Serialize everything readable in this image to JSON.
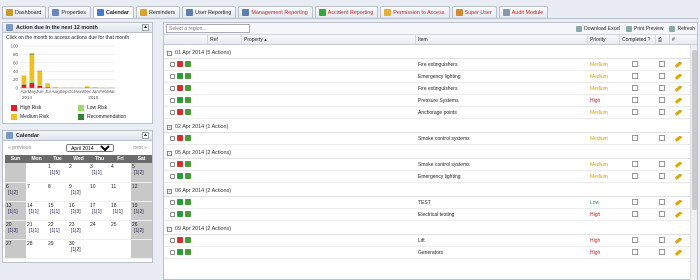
{
  "tabs": [
    {
      "label": "Dashboard",
      "color": "#c79a2b",
      "active": false,
      "red": false
    },
    {
      "label": "Properties",
      "color": "#6a88b5",
      "active": false,
      "red": false
    },
    {
      "label": "Calendar",
      "color": "#4a7cc2",
      "active": true,
      "red": false
    },
    {
      "label": "Reminders",
      "color": "#d9a233",
      "active": false,
      "red": false
    },
    {
      "label": "User Reporting",
      "color": "#5c7fb0",
      "active": false,
      "red": false
    },
    {
      "label": "Management Reporting",
      "color": "#5c7fb0",
      "active": false,
      "red": true
    },
    {
      "label": "Accident Reporting",
      "color": "#3aa33a",
      "active": false,
      "red": true
    },
    {
      "label": "Permission to Access",
      "color": "#e3b13a",
      "active": false,
      "red": true
    },
    {
      "label": "Super User",
      "color": "#d18b33",
      "active": false,
      "red": true
    },
    {
      "label": "Audit Module",
      "color": "#8899aa",
      "active": false,
      "red": true
    }
  ],
  "actions_panel": {
    "title": "Action due in the next 12 month",
    "hint": "Click on the month to access actions due for that month",
    "legend": [
      {
        "label": "High Risk",
        "color": "#e02020"
      },
      {
        "label": "Low Risk",
        "color": "#99dd66"
      },
      {
        "label": "Medium Risk",
        "color": "#f0c020"
      },
      {
        "label": "Recommendation",
        "color": "#2a8a2a"
      }
    ]
  },
  "chart_data": {
    "type": "bar",
    "stacked": true,
    "categories": [
      "Apr",
      "May",
      "Jun",
      "Jul",
      "Aug",
      "Sep",
      "Oct",
      "Nov",
      "Dec",
      "Jan",
      "Feb",
      "Mar"
    ],
    "year_labels": [
      "2014",
      "2015"
    ],
    "ylim": [
      0,
      100
    ],
    "yticks": [
      0,
      20,
      40,
      60,
      80,
      100
    ],
    "series": [
      {
        "name": "High Risk",
        "color": "#e02020",
        "values": [
          8,
          12,
          5,
          2,
          0,
          0,
          0,
          0,
          1,
          0,
          0,
          0
        ]
      },
      {
        "name": "Low Risk",
        "color": "#99dd66",
        "values": [
          4,
          6,
          3,
          1,
          0,
          0,
          0,
          0,
          0,
          0,
          0,
          0
        ]
      },
      {
        "name": "Medium Risk",
        "color": "#f0c020",
        "values": [
          18,
          62,
          32,
          8,
          2,
          1,
          1,
          1,
          3,
          2,
          0,
          1
        ]
      },
      {
        "name": "Recommendation",
        "color": "#2a8a2a",
        "values": [
          0,
          2,
          1,
          0,
          0,
          0,
          0,
          0,
          0,
          0,
          0,
          0
        ]
      }
    ]
  },
  "calendar": {
    "title": "Calendar",
    "prev": "« previous",
    "next": "next »",
    "month": "April 2014",
    "days": [
      "Sun",
      "Mon",
      "Tue",
      "Wed",
      "Thu",
      "Fri",
      "Sat"
    ],
    "weeks": [
      [
        {
          "d": "",
          "c": ""
        },
        {
          "d": "",
          "c": ""
        },
        {
          "d": "1",
          "c": "[1|5]"
        },
        {
          "d": "2",
          "c": ""
        },
        {
          "d": "3",
          "c": "[1|1]"
        },
        {
          "d": "4",
          "c": ""
        },
        {
          "d": "5",
          "c": "[1|2]"
        }
      ],
      [
        {
          "d": "6",
          "c": "[1|2]"
        },
        {
          "d": "7",
          "c": ""
        },
        {
          "d": "8",
          "c": ""
        },
        {
          "d": "9",
          "c": "[1|2]"
        },
        {
          "d": "10",
          "c": ""
        },
        {
          "d": "11",
          "c": ""
        },
        {
          "d": "12",
          "c": ""
        }
      ],
      [
        {
          "d": "13",
          "c": "[1|1]"
        },
        {
          "d": "14",
          "c": "[1|1]"
        },
        {
          "d": "15",
          "c": "[1|1]"
        },
        {
          "d": "16",
          "c": "[1|3]"
        },
        {
          "d": "17",
          "c": "[1|1]"
        },
        {
          "d": "18",
          "c": "[1|1]"
        },
        {
          "d": "19",
          "c": "[1|2]"
        }
      ],
      [
        {
          "d": "20",
          "c": "[1|3]"
        },
        {
          "d": "21",
          "c": "[1|1]"
        },
        {
          "d": "22",
          "c": "[1|1]"
        },
        {
          "d": "23",
          "c": "[1|2]"
        },
        {
          "d": "24",
          "c": ""
        },
        {
          "d": "25",
          "c": ""
        },
        {
          "d": "26",
          "c": "[1|2]"
        }
      ],
      [
        {
          "d": "27",
          "c": ""
        },
        {
          "d": "28",
          "c": ""
        },
        {
          "d": "29",
          "c": ""
        },
        {
          "d": "30",
          "c": "[1|2]"
        },
        {
          "d": "",
          "c": ""
        },
        {
          "d": "",
          "c": ""
        },
        {
          "d": "",
          "c": ""
        }
      ]
    ]
  },
  "toolbar": {
    "region_placeholder": "Select a region...",
    "download": "Download Excel",
    "print": "Print Preview",
    "refresh": "Refresh"
  },
  "grid": {
    "headers": {
      "ref": "Ref",
      "property": "Property",
      "item": "Item",
      "priority": "Priority",
      "completed": "Completed ?",
      "hash": "#"
    },
    "groups": [
      {
        "label": "01 Apr 2014 (5 Actions)",
        "rows": [
          {
            "item": "Fire extinguishers",
            "priority": "Medium",
            "pcolor": "#d9a000"
          },
          {
            "item": "Emergency lighting",
            "priority": "Medium",
            "pcolor": "#d9a000"
          },
          {
            "item": "Fire extinguishers",
            "priority": "Medium",
            "pcolor": "#d9a000"
          },
          {
            "item": "Pressure Systems",
            "priority": "High",
            "pcolor": "#d02020"
          },
          {
            "item": "Anchorage points",
            "priority": "Medium",
            "pcolor": "#d9a000"
          }
        ]
      },
      {
        "label": "02 Apr 2014 (1 Action)",
        "rows": [
          {
            "item": "Smoke control systems",
            "priority": "Medium",
            "pcolor": "#d9a000"
          }
        ]
      },
      {
        "label": "05 Apr 2014 (2 Actions)",
        "rows": [
          {
            "item": "Smoke control systems",
            "priority": "Medium",
            "pcolor": "#d9a000"
          },
          {
            "item": "Emergency lighting",
            "priority": "Medium",
            "pcolor": "#d9a000"
          }
        ]
      },
      {
        "label": "06 Apr 2014 (2 Actions)",
        "rows": [
          {
            "item": "TEST",
            "priority": "Low",
            "pcolor": "#3a9a3a"
          },
          {
            "item": "Electrical testing",
            "priority": "High",
            "pcolor": "#d02020"
          }
        ]
      },
      {
        "label": "09 Apr 2014 (2 Actions)",
        "rows": [
          {
            "item": "Lift",
            "priority": "High",
            "pcolor": "#d02020"
          },
          {
            "item": "Generators",
            "priority": "High",
            "pcolor": "#d02020"
          }
        ]
      }
    ]
  }
}
